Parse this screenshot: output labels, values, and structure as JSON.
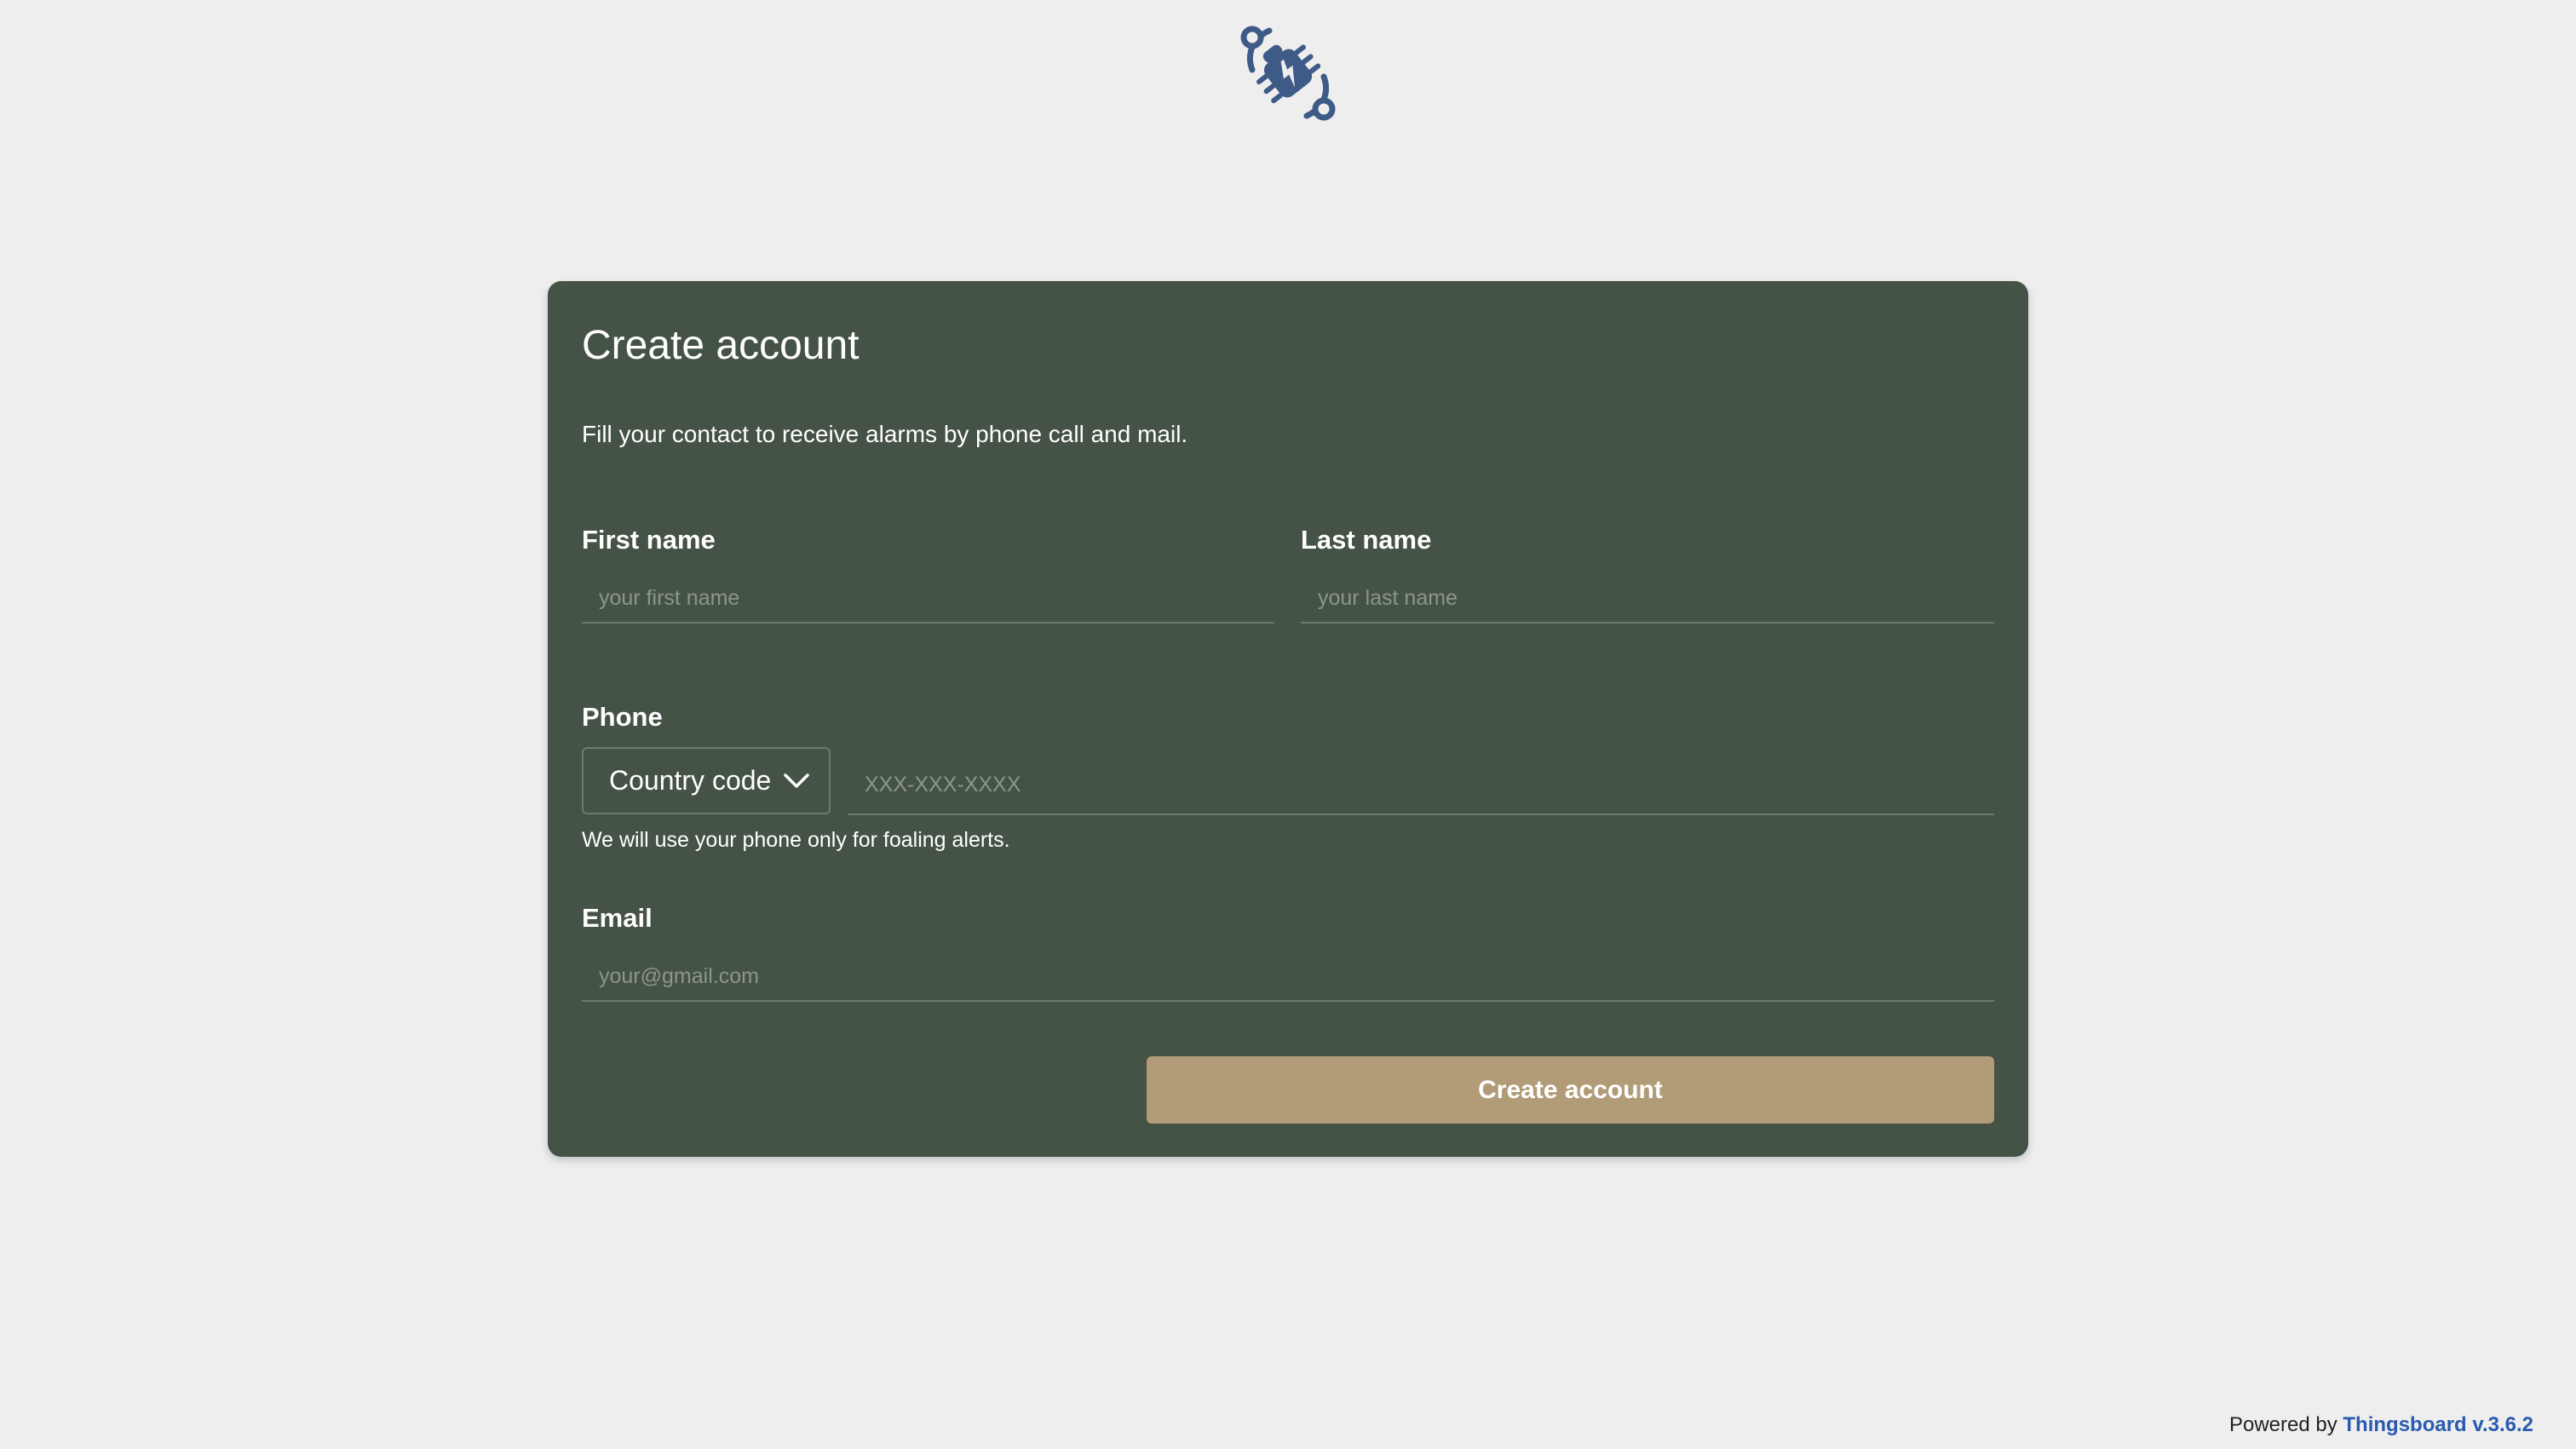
{
  "logo": {
    "icon": "bug-sync-icon",
    "color": "#3e5a86"
  },
  "card": {
    "title": "Create account",
    "subtitle": "Fill your contact to receive alarms by phone call and mail.",
    "background": "#455246"
  },
  "first_name": {
    "label": "First name",
    "placeholder": "your first name",
    "value": ""
  },
  "last_name": {
    "label": "Last name",
    "placeholder": "your last name",
    "value": ""
  },
  "phone": {
    "label": "Phone",
    "country_code": {
      "selected": "Country code",
      "icon": "chevron-down-icon"
    },
    "placeholder": "XXX-XXX-XXXX",
    "value": "",
    "helper": "We will use your phone only for foaling alerts."
  },
  "email": {
    "label": "Email",
    "placeholder": "your@gmail.com",
    "value": ""
  },
  "submit": {
    "label": "Create account",
    "color": "#b19c77"
  },
  "footer": {
    "prefix": "Powered by",
    "link_text": "Thingsboard v.3.6.2",
    "link_color": "#2a5ab0"
  }
}
